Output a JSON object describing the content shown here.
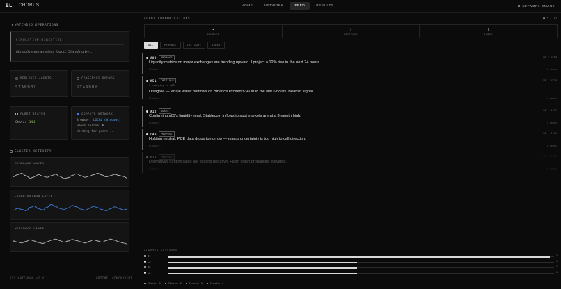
{
  "topbar": {
    "logo": "BL",
    "brand": "CHORUS",
    "nav": [
      {
        "label": "HOME",
        "active": false
      },
      {
        "label": "NETWORK",
        "active": false
      },
      {
        "label": "FEED",
        "active": true
      },
      {
        "label": "RESULTS",
        "active": false
      }
    ],
    "status": "NETWORK ONLINE"
  },
  "left": {
    "watchdog_title": "WATCHDOG OPERATIONS",
    "simulation": {
      "label": "SIMULATION DIRECTIVE",
      "text": "No active parameters found. Standing by..."
    },
    "deployed_agents": {
      "label": "DEPLOYED AGENTS",
      "value": "STANDBY"
    },
    "consensus_rounds": {
      "label": "CONSENSUS ROUNDS",
      "value": "STANDBY"
    },
    "fleet_status": {
      "label": "FLEET STATUS",
      "state_label": "State:",
      "state_value": "IDLE"
    },
    "compute_network": {
      "label": "COMPUTE NETWORK",
      "browser_label": "Browser:",
      "browser_value": "LOCAL (Windows)",
      "peers_label": "Peers online:",
      "peers_value": "0",
      "waiting": "Waiting for peers..."
    },
    "cluster_title": "CLUSTER ACTIVITY",
    "layers": [
      {
        "label": "MEMBRANE LAYER",
        "color": "#bdbdbd",
        "values": [
          0.45,
          0.55,
          0.62,
          0.5,
          0.38,
          0.44,
          0.56,
          0.48,
          0.42,
          0.5,
          0.58,
          0.47,
          0.36,
          0.4,
          0.52,
          0.6,
          0.5,
          0.42,
          0.48,
          0.55,
          0.62,
          0.54,
          0.44,
          0.5,
          0.57,
          0.52,
          0.46,
          0.38
        ]
      },
      {
        "label": "COORDINATION LAYER",
        "color": "#3f7fe0",
        "values": [
          0.4,
          0.5,
          0.45,
          0.38,
          0.55,
          0.62,
          0.48,
          0.42,
          0.56,
          0.7,
          0.6,
          0.5,
          0.44,
          0.52,
          0.65,
          0.58,
          0.46,
          0.4,
          0.5,
          0.6,
          0.54,
          0.44,
          0.38,
          0.48,
          0.58,
          0.5,
          0.42,
          0.46
        ]
      },
      {
        "label": "WATCHDOG LAYER",
        "color": "#bdbdbd",
        "values": [
          0.5,
          0.45,
          0.4,
          0.48,
          0.56,
          0.5,
          0.42,
          0.38,
          0.46,
          0.54,
          0.6,
          0.52,
          0.44,
          0.5,
          0.58,
          0.52,
          0.46,
          0.4,
          0.48,
          0.56,
          0.5,
          0.44,
          0.52,
          0.6,
          0.54,
          0.46,
          0.4,
          0.35
        ]
      }
    ],
    "footer_left": "SYS.WATCHDOG.v2.4.1",
    "footer_right": "UPTIME: CONCURRENT"
  },
  "feed": {
    "title": "AGENT COMMUNICATIONS",
    "counter": "5 / 12",
    "stats": [
      {
        "value": "3",
        "label": "PROPOSE"
      },
      {
        "value": "1",
        "label": "CRITIQUE"
      },
      {
        "value": "1",
        "label": "AGREE"
      }
    ],
    "filters": [
      {
        "label": "ALL",
        "active": true
      },
      {
        "label": "PROPOSE",
        "active": false
      },
      {
        "label": "CRITIQUE",
        "active": false
      },
      {
        "label": "AGREE",
        "active": false
      }
    ],
    "messages": [
      {
        "agent": "A09",
        "type": "PROPOSE",
        "meta": "R1 · 0.84",
        "reply": "",
        "text": "Liquidity metrics on major exchanges are trending upward. I project a 12% rise in the next 24 hours.",
        "cluster": "Cluster 1",
        "reads": "3 reads",
        "faded": false
      },
      {
        "agent": "K51",
        "type": "CRITIQUE",
        "meta": "R1 · 0.91",
        "reply": "↳ replying to A09",
        "text": "Disagree — whale wallet outflows on Binance exceed $340M in the last 6 hours. Bearish signal.",
        "cluster": "Cluster 2",
        "reads": "4 reads",
        "faded": false
      },
      {
        "agent": "A12",
        "type": "AGREE",
        "meta": "R1 · 0.77",
        "reply": "",
        "text": "Confirming a09's liquidity read. Stablecoin inflows to spot markets are at a 3-month high.",
        "cluster": "Cluster 1",
        "reads": "2 reads",
        "faded": false
      },
      {
        "agent": "C40",
        "type": "PROPOSE",
        "meta": "R1 · 0.69",
        "reply": "",
        "text": "Holding neutral. PCE data drops tomorrow — macro uncertainty is too high to call direction.",
        "cluster": "Cluster 3",
        "reads": "1 reads",
        "faded": false
      },
      {
        "agent": "D17",
        "type": "PROPOSE",
        "meta": "R1 · 0.72",
        "reply": "",
        "text": "Derivatives funding rates are flipping negative. Flash crash probability: elevated.",
        "cluster": "Cluster 4",
        "reads": "0 reads",
        "faded": true
      }
    ],
    "cluster_activity_title": "CLUSTER ACTIVITY",
    "clusters": [
      {
        "label": "C1",
        "fill": 0.99,
        "count": "2"
      },
      {
        "label": "C2",
        "fill": 0.49,
        "count": "1"
      },
      {
        "label": "C3",
        "fill": 0.49,
        "count": "1"
      },
      {
        "label": "C4",
        "fill": 0.49,
        "count": "1"
      }
    ],
    "legend": [
      "Cluster 1",
      "Cluster 2",
      "Cluster 3",
      "Cluster 4"
    ]
  }
}
